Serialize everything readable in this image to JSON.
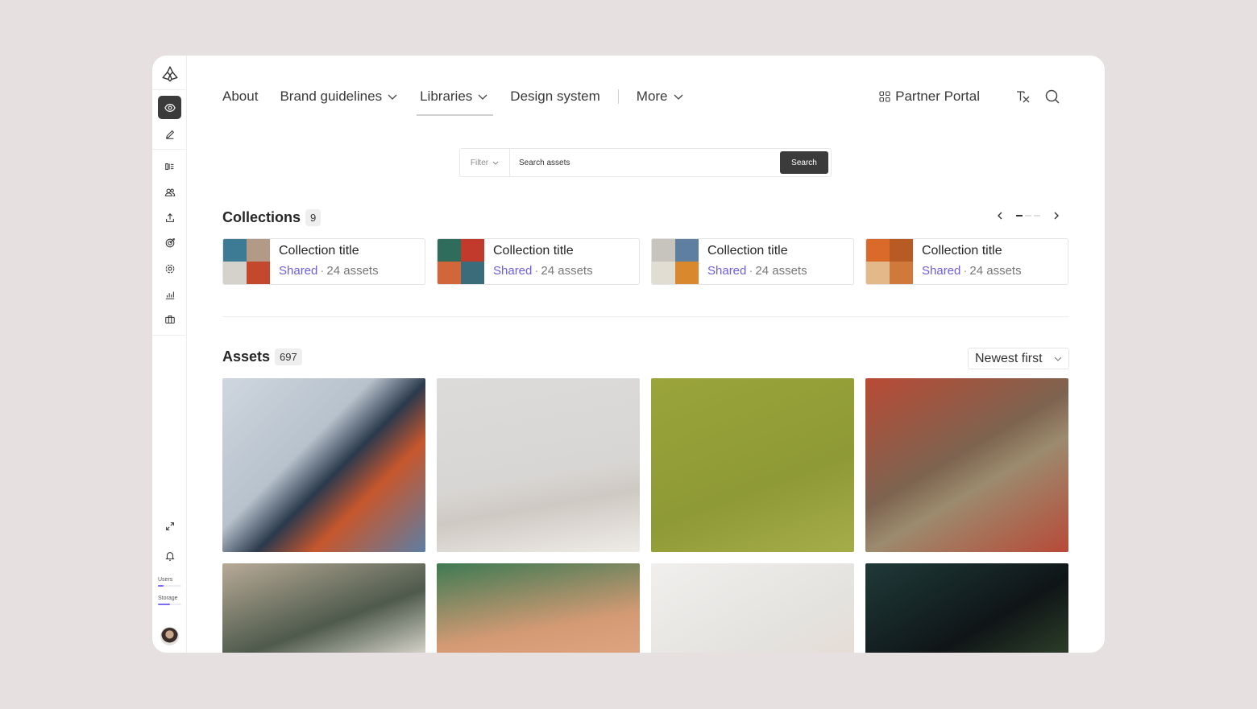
{
  "nav": {
    "items": [
      {
        "label": "About",
        "has_dropdown": false,
        "active": false
      },
      {
        "label": "Brand guidelines",
        "has_dropdown": true,
        "active": false
      },
      {
        "label": "Libraries",
        "has_dropdown": true,
        "active": true
      },
      {
        "label": "Design system",
        "has_dropdown": false,
        "active": false
      }
    ],
    "more_label": "More",
    "partner_portal": "Partner Portal"
  },
  "search": {
    "filter_label": "Filter",
    "placeholder": "Search assets",
    "button_label": "Search"
  },
  "sidebar": {
    "top_icons": [
      "eye-icon",
      "pencil-icon"
    ],
    "tool_icons": [
      "flow-icon",
      "users-icon",
      "share-icon",
      "target-icon",
      "settings-icon",
      "chart-icon",
      "briefcase-icon"
    ],
    "bottom_icons": [
      "expand-icon",
      "bell-icon"
    ],
    "users_label": "Users",
    "storage_label": "Storage",
    "users_fraction": 0.25,
    "storage_fraction": 0.5
  },
  "collections": {
    "title": "Collections",
    "count": "9",
    "pages": 3,
    "current_page": 1,
    "items": [
      {
        "title": "Collection title",
        "status": "Shared",
        "assets": "24 assets",
        "colors": [
          "#3d7a93",
          "#b39a87",
          "#d5d2cc",
          "#c4482b"
        ]
      },
      {
        "title": "Collection title",
        "status": "Shared",
        "assets": "24 assets",
        "colors": [
          "#2f6c5c",
          "#c23a2b",
          "#d0663a",
          "#3b6c7a"
        ]
      },
      {
        "title": "Collection title",
        "status": "Shared",
        "assets": "24 assets",
        "colors": [
          "#c7c3bd",
          "#5e7fa0",
          "#e2ddd3",
          "#d9882e"
        ]
      },
      {
        "title": "Collection title",
        "status": "Shared",
        "assets": "24 assets",
        "colors": [
          "#d96a2a",
          "#b85a24",
          "#e3b98a",
          "#cf7a3a"
        ]
      }
    ]
  },
  "assets": {
    "title": "Assets",
    "count": "697",
    "sort_label": "Newest first",
    "items": [
      {
        "bg": "linear-gradient(135deg,#cfd6df 0%,#b7c2cc 40%,#2b3a4d 55%,#c6572d 70%,#5d7ea3 100%)"
      },
      {
        "bg": "linear-gradient(170deg,#dcdbda 0%,#d8d6d4 55%,#cfc9c3 70%,#efece7 100%)"
      },
      {
        "bg": "linear-gradient(160deg,#9aa43b 0%,#8e9a35 60%,#a5ad4a 100%)"
      },
      {
        "bg": "linear-gradient(150deg,#b94a35 0%,#7d6450 45%,#9c8b6e 60%,#b74a38 100%)"
      },
      {
        "bg": "linear-gradient(160deg,#b8aa97 0%,#4e5a4c 40%,#e9e4dc 70%,#c0b5a5 100%)"
      },
      {
        "bg": "linear-gradient(170deg,#3e7a53 0%,#d39a74 40%,#e2a987 70%,#c68664 100%)"
      },
      {
        "bg": "linear-gradient(150deg,#f0efed 0%,#e4e2df 50%,#e8d6c8 100%)"
      },
      {
        "bg": "linear-gradient(150deg,#1f3a38 0%,#0f1517 45%,#4c6a3b 100%)"
      }
    ]
  }
}
